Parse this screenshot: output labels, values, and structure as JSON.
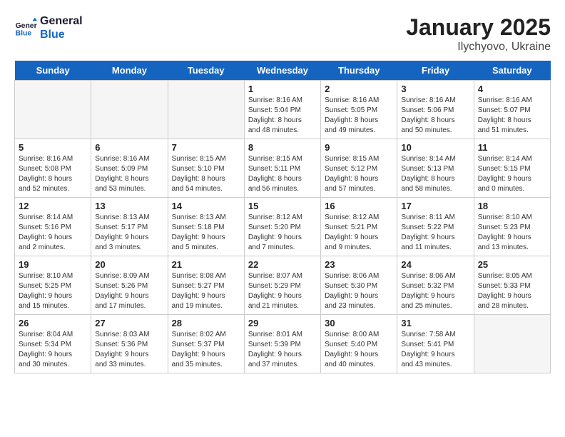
{
  "header": {
    "logo_line1": "General",
    "logo_line2": "Blue",
    "month": "January 2025",
    "location": "Ilychyovo, Ukraine"
  },
  "weekdays": [
    "Sunday",
    "Monday",
    "Tuesday",
    "Wednesday",
    "Thursday",
    "Friday",
    "Saturday"
  ],
  "weeks": [
    [
      {
        "day": "",
        "info": ""
      },
      {
        "day": "",
        "info": ""
      },
      {
        "day": "",
        "info": ""
      },
      {
        "day": "1",
        "info": "Sunrise: 8:16 AM\nSunset: 5:04 PM\nDaylight: 8 hours\nand 48 minutes."
      },
      {
        "day": "2",
        "info": "Sunrise: 8:16 AM\nSunset: 5:05 PM\nDaylight: 8 hours\nand 49 minutes."
      },
      {
        "day": "3",
        "info": "Sunrise: 8:16 AM\nSunset: 5:06 PM\nDaylight: 8 hours\nand 50 minutes."
      },
      {
        "day": "4",
        "info": "Sunrise: 8:16 AM\nSunset: 5:07 PM\nDaylight: 8 hours\nand 51 minutes."
      }
    ],
    [
      {
        "day": "5",
        "info": "Sunrise: 8:16 AM\nSunset: 5:08 PM\nDaylight: 8 hours\nand 52 minutes."
      },
      {
        "day": "6",
        "info": "Sunrise: 8:16 AM\nSunset: 5:09 PM\nDaylight: 8 hours\nand 53 minutes."
      },
      {
        "day": "7",
        "info": "Sunrise: 8:15 AM\nSunset: 5:10 PM\nDaylight: 8 hours\nand 54 minutes."
      },
      {
        "day": "8",
        "info": "Sunrise: 8:15 AM\nSunset: 5:11 PM\nDaylight: 8 hours\nand 56 minutes."
      },
      {
        "day": "9",
        "info": "Sunrise: 8:15 AM\nSunset: 5:12 PM\nDaylight: 8 hours\nand 57 minutes."
      },
      {
        "day": "10",
        "info": "Sunrise: 8:14 AM\nSunset: 5:13 PM\nDaylight: 8 hours\nand 58 minutes."
      },
      {
        "day": "11",
        "info": "Sunrise: 8:14 AM\nSunset: 5:15 PM\nDaylight: 9 hours\nand 0 minutes."
      }
    ],
    [
      {
        "day": "12",
        "info": "Sunrise: 8:14 AM\nSunset: 5:16 PM\nDaylight: 9 hours\nand 2 minutes."
      },
      {
        "day": "13",
        "info": "Sunrise: 8:13 AM\nSunset: 5:17 PM\nDaylight: 9 hours\nand 3 minutes."
      },
      {
        "day": "14",
        "info": "Sunrise: 8:13 AM\nSunset: 5:18 PM\nDaylight: 9 hours\nand 5 minutes."
      },
      {
        "day": "15",
        "info": "Sunrise: 8:12 AM\nSunset: 5:20 PM\nDaylight: 9 hours\nand 7 minutes."
      },
      {
        "day": "16",
        "info": "Sunrise: 8:12 AM\nSunset: 5:21 PM\nDaylight: 9 hours\nand 9 minutes."
      },
      {
        "day": "17",
        "info": "Sunrise: 8:11 AM\nSunset: 5:22 PM\nDaylight: 9 hours\nand 11 minutes."
      },
      {
        "day": "18",
        "info": "Sunrise: 8:10 AM\nSunset: 5:23 PM\nDaylight: 9 hours\nand 13 minutes."
      }
    ],
    [
      {
        "day": "19",
        "info": "Sunrise: 8:10 AM\nSunset: 5:25 PM\nDaylight: 9 hours\nand 15 minutes."
      },
      {
        "day": "20",
        "info": "Sunrise: 8:09 AM\nSunset: 5:26 PM\nDaylight: 9 hours\nand 17 minutes."
      },
      {
        "day": "21",
        "info": "Sunrise: 8:08 AM\nSunset: 5:27 PM\nDaylight: 9 hours\nand 19 minutes."
      },
      {
        "day": "22",
        "info": "Sunrise: 8:07 AM\nSunset: 5:29 PM\nDaylight: 9 hours\nand 21 minutes."
      },
      {
        "day": "23",
        "info": "Sunrise: 8:06 AM\nSunset: 5:30 PM\nDaylight: 9 hours\nand 23 minutes."
      },
      {
        "day": "24",
        "info": "Sunrise: 8:06 AM\nSunset: 5:32 PM\nDaylight: 9 hours\nand 25 minutes."
      },
      {
        "day": "25",
        "info": "Sunrise: 8:05 AM\nSunset: 5:33 PM\nDaylight: 9 hours\nand 28 minutes."
      }
    ],
    [
      {
        "day": "26",
        "info": "Sunrise: 8:04 AM\nSunset: 5:34 PM\nDaylight: 9 hours\nand 30 minutes."
      },
      {
        "day": "27",
        "info": "Sunrise: 8:03 AM\nSunset: 5:36 PM\nDaylight: 9 hours\nand 33 minutes."
      },
      {
        "day": "28",
        "info": "Sunrise: 8:02 AM\nSunset: 5:37 PM\nDaylight: 9 hours\nand 35 minutes."
      },
      {
        "day": "29",
        "info": "Sunrise: 8:01 AM\nSunset: 5:39 PM\nDaylight: 9 hours\nand 37 minutes."
      },
      {
        "day": "30",
        "info": "Sunrise: 8:00 AM\nSunset: 5:40 PM\nDaylight: 9 hours\nand 40 minutes."
      },
      {
        "day": "31",
        "info": "Sunrise: 7:58 AM\nSunset: 5:41 PM\nDaylight: 9 hours\nand 43 minutes."
      },
      {
        "day": "",
        "info": ""
      }
    ]
  ]
}
